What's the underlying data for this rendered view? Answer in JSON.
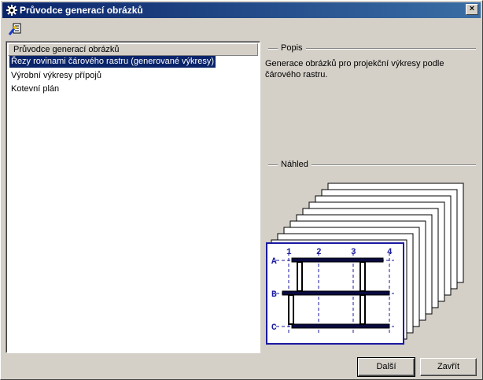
{
  "window": {
    "title": "Průvodce generací obrázků",
    "close_label": "×"
  },
  "list": {
    "header": "Průvodce generací obrázků",
    "items": [
      {
        "label": "Řezy rovinami čárového rastru (generované výkresy)",
        "selected": true
      },
      {
        "label": "Výrobní výkresy přípojů",
        "selected": false
      },
      {
        "label": "Kotevní plán",
        "selected": false
      }
    ]
  },
  "description": {
    "group_label": "Popis",
    "text": "Generace obrázků pro projekční výkresy podle čárového rastru."
  },
  "preview": {
    "group_label": "Náhled",
    "column_labels": [
      "1",
      "2",
      "3",
      "4"
    ],
    "row_labels": [
      "A",
      "B",
      "C"
    ]
  },
  "buttons": {
    "next": "Další",
    "close": "Zavřít"
  },
  "colors": {
    "accent": "#0a246a",
    "selection": "#0a246a",
    "preview_line": "#1a1aa0"
  }
}
